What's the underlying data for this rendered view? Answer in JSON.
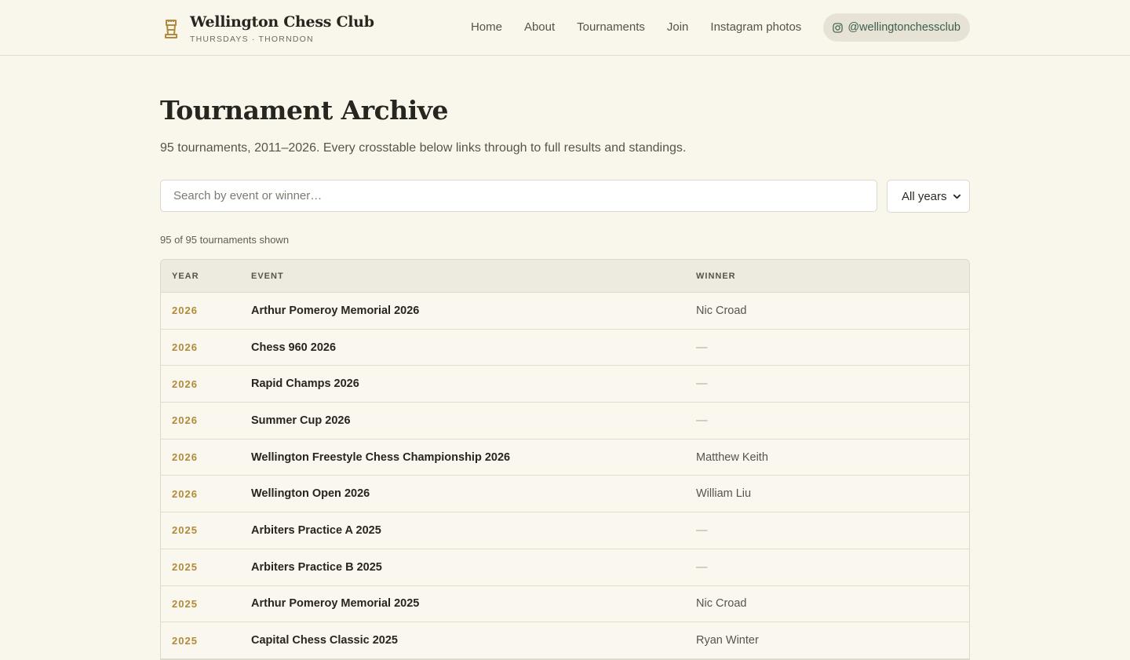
{
  "brand": {
    "name": "Wellington Chess Club",
    "tagline": "THURSDAYS · THORNDON"
  },
  "nav": {
    "items": [
      "Home",
      "About",
      "Tournaments",
      "Join",
      "Instagram photos"
    ],
    "instagram_handle": "@wellingtonchessclub"
  },
  "page": {
    "title": "Tournament Archive",
    "subtitle": "95 tournaments, 2011–2026. Every crosstable below links through to full results and standings."
  },
  "search": {
    "placeholder": "Search by event or winner…",
    "value": ""
  },
  "year_filter": {
    "selected": "All years"
  },
  "results_count": "95 of 95 tournaments shown",
  "table": {
    "headers": {
      "year": "YEAR",
      "event": "EVENT",
      "winner": "WINNER"
    },
    "rows": [
      {
        "year": "2026",
        "event": "Arthur Pomeroy Memorial 2026",
        "winner": "Nic Croad"
      },
      {
        "year": "2026",
        "event": "Chess 960 2026",
        "winner": "—"
      },
      {
        "year": "2026",
        "event": "Rapid Champs 2026",
        "winner": "—"
      },
      {
        "year": "2026",
        "event": "Summer Cup 2026",
        "winner": "—"
      },
      {
        "year": "2026",
        "event": "Wellington Freestyle Chess Championship 2026",
        "winner": "Matthew Keith"
      },
      {
        "year": "2026",
        "event": "Wellington Open 2026",
        "winner": "William Liu"
      },
      {
        "year": "2025",
        "event": "Arbiters Practice A 2025",
        "winner": "—"
      },
      {
        "year": "2025",
        "event": "Arbiters Practice B 2025",
        "winner": "—"
      },
      {
        "year": "2025",
        "event": "Arthur Pomeroy Memorial 2025",
        "winner": "Nic Croad"
      },
      {
        "year": "2025",
        "event": "Capital Chess Classic 2025",
        "winner": "Ryan Winter"
      }
    ]
  },
  "colors": {
    "background": "#f9f6ec",
    "year_accent": "#b18a3c",
    "instagram_text": "#3d5e4c",
    "header_row": "#edeae0"
  },
  "icons": {
    "brand": "chess-rook-icon",
    "instagram": "instagram-icon",
    "select": "chevron-down-icon"
  }
}
